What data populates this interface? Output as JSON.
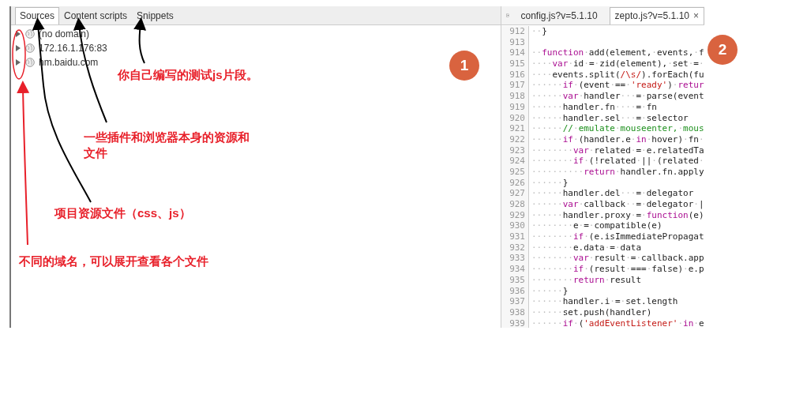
{
  "sources_panel": {
    "tabs": [
      {
        "label": "Sources",
        "selected": true
      },
      {
        "label": "Content scripts",
        "selected": false
      },
      {
        "label": "Snippets",
        "selected": false
      }
    ],
    "tree": [
      {
        "label": "(no domain)",
        "expanded": false
      },
      {
        "label": "172.16.1.176:83",
        "expanded": false
      },
      {
        "label": "hm.baidu.com",
        "expanded": false
      }
    ]
  },
  "editor": {
    "tabs": [
      {
        "label": "config.js?v=5.1.10",
        "selected": false,
        "closable": false
      },
      {
        "label": "zepto.js?v=5.1.10",
        "selected": true,
        "closable": true
      }
    ],
    "close_glyph": "×",
    "lines": [
      {
        "number": "912",
        "code": [
          {
            "kind": "plain",
            "text": "··}"
          }
        ]
      },
      {
        "number": "913"
      },
      {
        "number": "914",
        "code": [
          {
            "kind": "plain",
            "text": "··"
          },
          {
            "kind": "keyword",
            "text": "function"
          },
          {
            "kind": "plain",
            "text": "·add(element,·events,·f"
          }
        ]
      },
      {
        "number": "915",
        "code": [
          {
            "kind": "plain",
            "text": "····"
          },
          {
            "kind": "keyword",
            "text": "var"
          },
          {
            "kind": "plain",
            "text": "·id·=·zid(element),·set·=·"
          }
        ]
      },
      {
        "number": "916",
        "code": [
          {
            "kind": "plain",
            "text": "····events.split("
          },
          {
            "kind": "string",
            "text": "/\\s/"
          },
          {
            "kind": "plain",
            "text": ").forEach(fu"
          }
        ]
      },
      {
        "number": "917",
        "code": [
          {
            "kind": "plain",
            "text": "······"
          },
          {
            "kind": "keyword",
            "text": "if"
          },
          {
            "kind": "plain",
            "text": "·(event·==·"
          },
          {
            "kind": "string",
            "text": "'ready'"
          },
          {
            "kind": "plain",
            "text": ")·"
          },
          {
            "kind": "keyword",
            "text": "retur"
          }
        ]
      },
      {
        "number": "918",
        "code": [
          {
            "kind": "plain",
            "text": "······"
          },
          {
            "kind": "keyword",
            "text": "var"
          },
          {
            "kind": "plain",
            "text": "·handler···=·parse(event"
          }
        ]
      },
      {
        "number": "919",
        "code": [
          {
            "kind": "plain",
            "text": "······handler.fn····=·fn"
          }
        ]
      },
      {
        "number": "920",
        "code": [
          {
            "kind": "plain",
            "text": "······handler.sel···=·selector"
          }
        ]
      },
      {
        "number": "921",
        "code": [
          {
            "kind": "plain",
            "text": "······"
          },
          {
            "kind": "comment",
            "text": "//·emulate·mouseenter,·mous"
          }
        ]
      },
      {
        "number": "922",
        "code": [
          {
            "kind": "plain",
            "text": "······"
          },
          {
            "kind": "keyword",
            "text": "if"
          },
          {
            "kind": "plain",
            "text": "·(handler.e·"
          },
          {
            "kind": "keyword",
            "text": "in"
          },
          {
            "kind": "plain",
            "text": "·hover)·fn·"
          }
        ]
      },
      {
        "number": "923",
        "code": [
          {
            "kind": "plain",
            "text": "········"
          },
          {
            "kind": "keyword",
            "text": "var"
          },
          {
            "kind": "plain",
            "text": "·related·=·e.relatedTa"
          }
        ]
      },
      {
        "number": "924",
        "code": [
          {
            "kind": "plain",
            "text": "········"
          },
          {
            "kind": "keyword",
            "text": "if"
          },
          {
            "kind": "plain",
            "text": "·(!related·||·(related·"
          }
        ]
      },
      {
        "number": "925",
        "code": [
          {
            "kind": "plain",
            "text": "··········"
          },
          {
            "kind": "keyword",
            "text": "return"
          },
          {
            "kind": "plain",
            "text": "·handler.fn.apply"
          }
        ]
      },
      {
        "number": "926",
        "code": [
          {
            "kind": "plain",
            "text": "······}"
          }
        ]
      },
      {
        "number": "927",
        "code": [
          {
            "kind": "plain",
            "text": "······handler.del···=·delegator"
          }
        ]
      },
      {
        "number": "928",
        "code": [
          {
            "kind": "plain",
            "text": "······"
          },
          {
            "kind": "keyword",
            "text": "var"
          },
          {
            "kind": "plain",
            "text": "·callback··=·delegator·|"
          }
        ]
      },
      {
        "number": "929",
        "code": [
          {
            "kind": "plain",
            "text": "······handler.proxy·=·"
          },
          {
            "kind": "keyword",
            "text": "function"
          },
          {
            "kind": "plain",
            "text": "(e)"
          }
        ]
      },
      {
        "number": "930",
        "code": [
          {
            "kind": "plain",
            "text": "········e·=·compatible(e)"
          }
        ]
      },
      {
        "number": "931",
        "code": [
          {
            "kind": "plain",
            "text": "········"
          },
          {
            "kind": "keyword",
            "text": "if"
          },
          {
            "kind": "plain",
            "text": "·(e.isImmediatePropagat"
          }
        ]
      },
      {
        "number": "932",
        "code": [
          {
            "kind": "plain",
            "text": "········e.data·=·data"
          }
        ]
      },
      {
        "number": "933",
        "code": [
          {
            "kind": "plain",
            "text": "········"
          },
          {
            "kind": "keyword",
            "text": "var"
          },
          {
            "kind": "plain",
            "text": "·result·=·callback.app"
          }
        ]
      },
      {
        "number": "934",
        "code": [
          {
            "kind": "plain",
            "text": "········"
          },
          {
            "kind": "keyword",
            "text": "if"
          },
          {
            "kind": "plain",
            "text": "·(result·===·false)·e.p"
          }
        ]
      },
      {
        "number": "935",
        "code": [
          {
            "kind": "plain",
            "text": "········"
          },
          {
            "kind": "keyword",
            "text": "return"
          },
          {
            "kind": "plain",
            "text": "·result"
          }
        ]
      },
      {
        "number": "936",
        "code": [
          {
            "kind": "plain",
            "text": "······}"
          }
        ]
      },
      {
        "number": "937",
        "code": [
          {
            "kind": "plain",
            "text": "······handler.i·=·set.length"
          }
        ]
      },
      {
        "number": "938",
        "code": [
          {
            "kind": "plain",
            "text": "······set.push(handler)"
          }
        ]
      },
      {
        "number": "939",
        "code": [
          {
            "kind": "plain",
            "text": "······"
          },
          {
            "kind": "keyword",
            "text": "if"
          },
          {
            "kind": "plain",
            "text": "·("
          },
          {
            "kind": "string",
            "text": "'addEventListener'"
          },
          {
            "kind": "plain",
            "text": "·"
          },
          {
            "kind": "keyword",
            "text": "in"
          },
          {
            "kind": "plain",
            "text": "·e"
          }
        ]
      }
    ]
  },
  "annotations": {
    "badges": [
      {
        "label": "1"
      },
      {
        "label": "2"
      }
    ],
    "notes": [
      "你自己编写的测试js片段。",
      "一些插件和浏览器本身的资源和文件",
      "项目资源文件（css、js）",
      "不同的域名，可以展开查看各个文件"
    ]
  }
}
